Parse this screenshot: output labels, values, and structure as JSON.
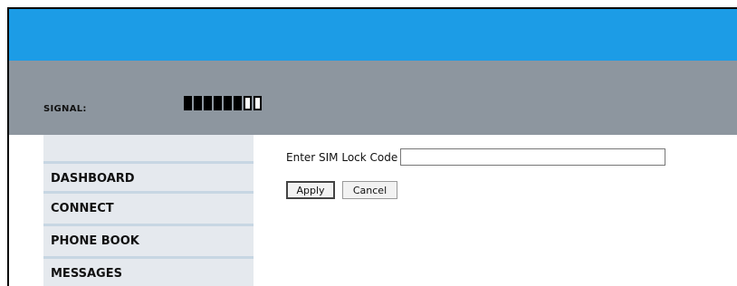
{
  "header": {
    "signal_label": "SIGNAL:",
    "signal_strength": {
      "filled": 6,
      "total": 8
    },
    "colors": {
      "top_bar": "#1c9ce6",
      "gray_bar": "#8d969f"
    }
  },
  "sidebar": {
    "items": [
      {
        "label": "DASHBOARD"
      },
      {
        "label": "CONNECT"
      },
      {
        "label": "PHONE BOOK"
      },
      {
        "label": "MESSAGES"
      }
    ]
  },
  "form": {
    "sim_lock_label": "Enter SIM Lock Code",
    "sim_lock_value": "",
    "apply_label": "Apply",
    "cancel_label": "Cancel"
  }
}
